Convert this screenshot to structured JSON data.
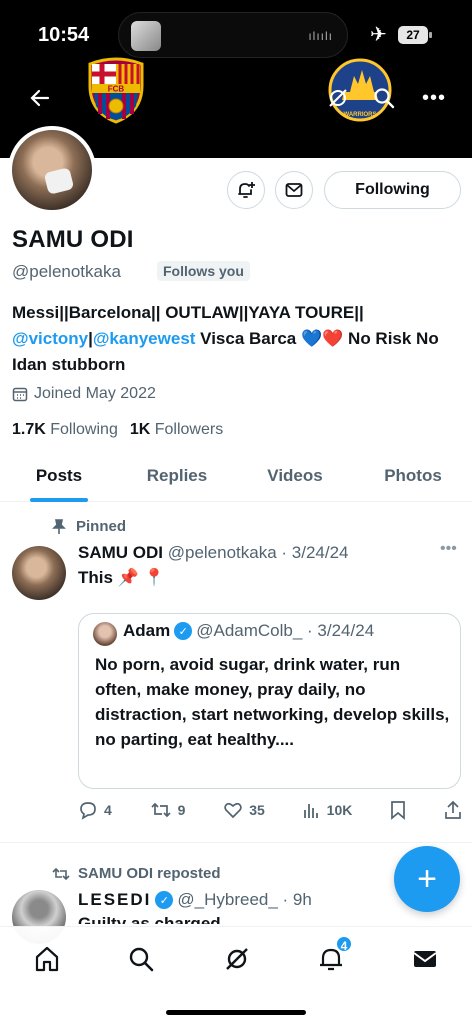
{
  "status_bar": {
    "time": "10:54",
    "battery": "27"
  },
  "header": {
    "back_icon": "back-arrow-icon",
    "grok_icon": "grok-icon",
    "search_icon": "search-icon",
    "more_icon": "more-icon",
    "banner_left_logo_text": "FCB",
    "banner_right_logo_text": "GOLDEN STATE WARRIORS"
  },
  "profile": {
    "display_name": "SAMU ODI",
    "handle": "@pelenotkaka",
    "follows_you": "Follows you",
    "following_button": "Following",
    "bio_part1": "Messi||Barcelona|| OUTLAW||YAYA TOURE|| ",
    "bio_link1": "@victony",
    "bio_sep": "|",
    "bio_link2": "@kanyewest",
    "bio_part2": " Visca Barca 💙❤️ No Risk No Idan stubborn",
    "joined": "Joined May 2022",
    "following_count": "1.7K",
    "following_label": "Following",
    "followers_count": "1K",
    "followers_label": "Followers"
  },
  "tabs": [
    "Posts",
    "Replies",
    "Videos",
    "Photos"
  ],
  "pinned_tweet": {
    "pinned_label": "Pinned",
    "name": "SAMU ODI",
    "meta": "@pelenotkaka · 3/24/24",
    "text": "This 📌 📍",
    "quote": {
      "name": "Adam",
      "meta": "@AdamColb_ · 3/24/24",
      "text": "No porn, avoid sugar, drink water, run often, make money, pray daily, no distraction, start networking, develop skills, no parting, eat healthy...."
    },
    "replies": "4",
    "reposts": "9",
    "likes": "35",
    "views": "10K"
  },
  "second_tweet": {
    "repost_label": "SAMU ODI reposted",
    "name": "LESEDI",
    "meta": "@_Hybreed_ · 9h",
    "text": "Guilty as charged"
  },
  "bottom_nav": {
    "notif_count": "4"
  },
  "colors": {
    "accent": "#1d9bf0",
    "text": "#0f1419",
    "muted": "#536471"
  }
}
